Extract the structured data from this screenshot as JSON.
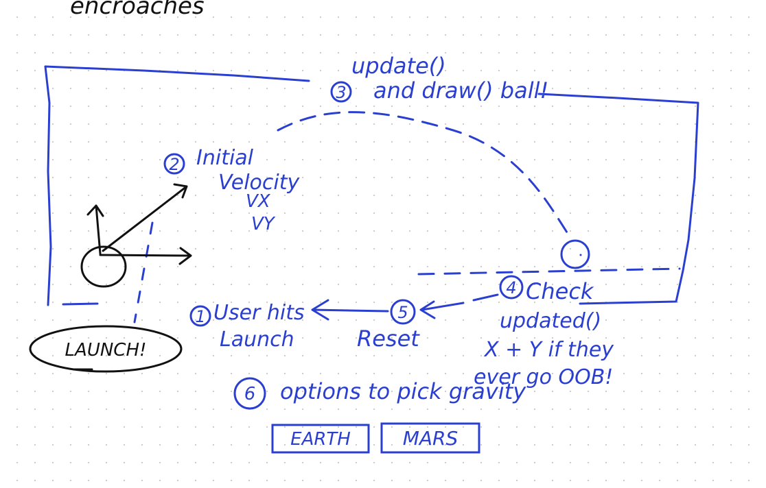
{
  "header_fragment": "encroaches",
  "colors": {
    "ink_blue": "#2a3fd0",
    "ink_black": "#111111",
    "paper": "#ffffff",
    "dots": "#c9c9c9"
  },
  "steps": {
    "s1": {
      "number": "1",
      "line1": "User hits",
      "line2": "Launch"
    },
    "s2": {
      "number": "2",
      "line1": "Initial",
      "line2": "Velocity",
      "line3": "VX",
      "line4": "VY"
    },
    "s3": {
      "number": "3",
      "pre": "update()",
      "line1": "and draw() ball!"
    },
    "s4": {
      "number": "4",
      "line1": "Check",
      "line2": "updated()",
      "line3": "X + Y if they",
      "line4": "ever go OOB!"
    },
    "s5": {
      "number": "5",
      "line1": "Reset"
    },
    "s6": {
      "number": "6",
      "line1": "options to pick gravity"
    }
  },
  "buttons": {
    "launch": "LAUNCH!",
    "earth": "EARTH",
    "mars": "MARS"
  }
}
